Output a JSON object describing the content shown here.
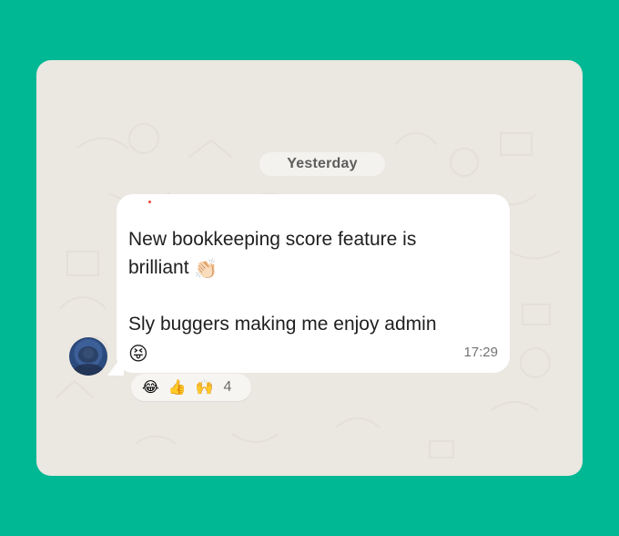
{
  "app": {
    "background_color": "#00b894",
    "chat_background_color": "#ebe7e1"
  },
  "chat": {
    "date_label": "Yesterday",
    "message": {
      "line_1": "New bookkeeping score feature is",
      "line_2_text": "brilliant",
      "line_2_emoji": "👏🏻",
      "line_3_text": "Sly buggers making me enjoy admin",
      "line_4_emoji": "😝",
      "time": "17:29"
    },
    "reactions": {
      "items": [
        "😂",
        "👍",
        "🙌"
      ],
      "count": "4"
    }
  }
}
